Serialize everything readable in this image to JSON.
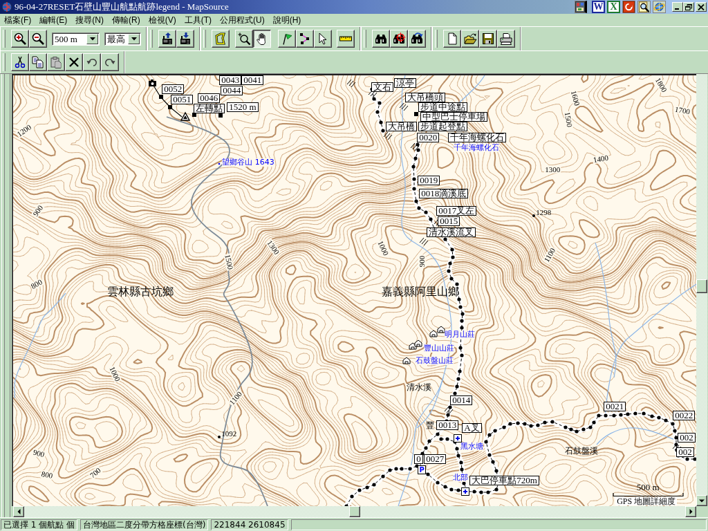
{
  "window": {
    "title": "96-04-27RESET石壁山豐山航點航跡legend - MapSource"
  },
  "quick_launch": [
    {
      "kind": "picture"
    },
    {
      "kind": "letter",
      "glyph": "W",
      "color": "#1c2a9c"
    },
    {
      "kind": "letter",
      "glyph": "X",
      "color": "#1e7a30"
    },
    {
      "kind": "ring"
    },
    {
      "kind": "magnifier"
    },
    {
      "kind": "globe"
    }
  ],
  "menu": [
    "檔案(F)",
    "編輯(E)",
    "搜尋(N)",
    "傳輸(R)",
    "檢視(V)",
    "工具(T)",
    "公用程式(U)",
    "說明(H)"
  ],
  "toolbar": {
    "scale": "500 m",
    "detail": "最高"
  },
  "map_tools": [
    {
      "kind": "area",
      "selected": false
    },
    {
      "kind": "zoom",
      "selected": false
    },
    {
      "kind": "pan",
      "selected": true
    },
    {
      "kind": "waypoint",
      "selected": false
    },
    {
      "kind": "route",
      "selected": false
    },
    {
      "kind": "select",
      "selected": false
    },
    {
      "kind": "measure",
      "selected": false
    }
  ],
  "edit_tools": [
    {
      "kind": "cut",
      "disabled": false
    },
    {
      "kind": "copy",
      "disabled": false
    },
    {
      "kind": "paste",
      "disabled": true
    },
    {
      "kind": "delete",
      "disabled": false
    },
    {
      "kind": "undo",
      "disabled": true
    },
    {
      "kind": "redo",
      "disabled": true
    }
  ],
  "map": {
    "waypoint_labels": [
      "0043",
      "0041",
      "涼亭",
      "0052",
      "0044",
      "文右",
      "0051",
      "0046",
      "大吊橋頭",
      "左轉點",
      "1520 m",
      "步道中途點",
      "中型巴士停車場",
      "大吊橋",
      "步道起登點",
      "0020",
      "千年海螺化石",
      "0019",
      "0018滴溪底",
      "0017叉左",
      "0015",
      "清水溪流叉",
      "0014",
      "0021",
      "0022",
      "0013",
      "A叉",
      "002",
      "002",
      "0",
      "0027",
      "大巴停車點720m"
    ],
    "elevation_labels": [
      "1800",
      "1600",
      "1700",
      "1500",
      "1200",
      "1400",
      "1300",
      "900",
      "1300",
      "1000",
      "1500",
      "900",
      "1100",
      "800",
      "1000",
      "1100",
      "900",
      "800",
      "700"
    ],
    "spot_heights": [
      "1298",
      "1092"
    ],
    "place_names": [
      "雲林縣古坑鄉",
      "嘉義縣阿里山鄉",
      "清水溪",
      "豐",
      "石鼓盤溪"
    ],
    "poi_labels": [
      "千年海螺化石",
      "望鄉谷山 1643",
      "明月山莊",
      "豐山山莊",
      "石鼓盤山莊",
      "黑水塘",
      "北部"
    ],
    "parking_sign": "P",
    "scale_bar": {
      "distance": "500 m",
      "caption": "GPS 地圖詳細度"
    }
  },
  "status_bar": [
    "已選擇 1 個航點 個",
    "台灣地區二度分帶方格座標(台灣)",
    "221844 2610845"
  ]
}
